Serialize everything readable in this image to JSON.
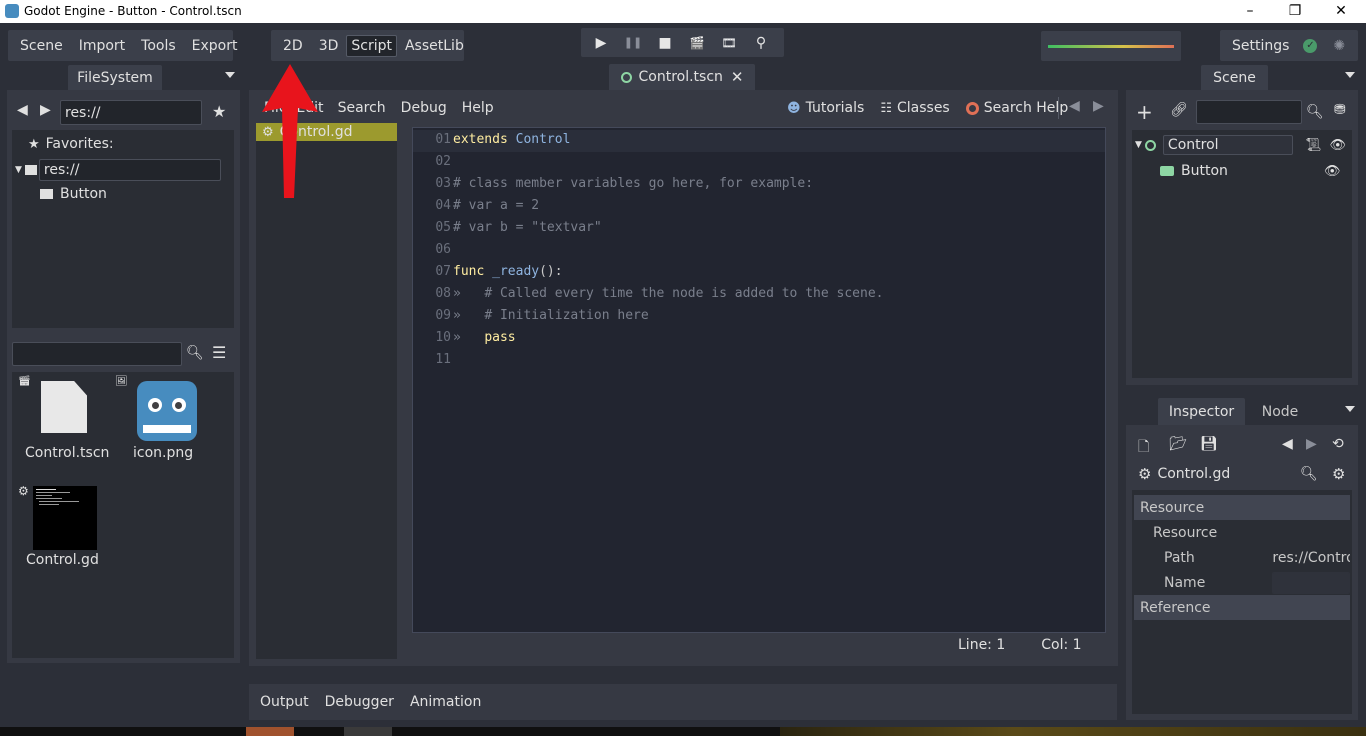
{
  "window": {
    "title": "Godot Engine - Button - Control.tscn",
    "minimize": "–",
    "restore": "❐",
    "close": "✕"
  },
  "menu": {
    "scene": "Scene",
    "import": "Import",
    "tools": "Tools",
    "export": "Export"
  },
  "workspaces": {
    "d2": "2D",
    "d3": "3D",
    "script": "Script",
    "assetlib": "AssetLib",
    "active": "Script"
  },
  "run": {
    "play": "▶",
    "pause": "❚❚",
    "stop": "■",
    "play_scene": "🎬",
    "play_custom": "🎞",
    "remote": "⚲"
  },
  "settings_label": "Settings",
  "filesystem": {
    "tab": "FileSystem",
    "path": "res://",
    "favorites": "Favorites:",
    "root": "res://",
    "folder": "Button",
    "search_placeholder": "",
    "files": [
      {
        "name": "Control.tscn",
        "type": "scene"
      },
      {
        "name": "icon.png",
        "type": "image"
      },
      {
        "name": "Control.gd",
        "type": "script"
      }
    ]
  },
  "editor": {
    "scene_tab": "Control.tscn",
    "script_menu": {
      "file": "File",
      "edit": "Edit",
      "search": "Search",
      "debug": "Debug",
      "help": "Help"
    },
    "links": {
      "tutorials": "Tutorials",
      "classes": "Classes",
      "search_help": "Search Help"
    },
    "script_list": [
      "Control.gd"
    ],
    "lines": [
      {
        "n": "01",
        "parts": [
          {
            "t": "extends",
            "c": "kw"
          },
          {
            "t": " ",
            "c": "tx"
          },
          {
            "t": "Control",
            "c": "tp"
          }
        ]
      },
      {
        "n": "02",
        "parts": []
      },
      {
        "n": "03",
        "parts": [
          {
            "t": "# class member variables go here, for example:",
            "c": "cm"
          }
        ]
      },
      {
        "n": "04",
        "parts": [
          {
            "t": "# var a = 2",
            "c": "cm"
          }
        ]
      },
      {
        "n": "05",
        "parts": [
          {
            "t": "# var b = \"textvar\"",
            "c": "cm"
          }
        ]
      },
      {
        "n": "06",
        "parts": []
      },
      {
        "n": "07",
        "parts": [
          {
            "t": "func",
            "c": "kw"
          },
          {
            "t": " ",
            "c": "tx"
          },
          {
            "t": "_ready",
            "c": "fn"
          },
          {
            "t": "():",
            "c": "tx"
          }
        ]
      },
      {
        "n": "08",
        "parts": [
          {
            "t": "»   ",
            "c": "cm"
          },
          {
            "t": "# Called every time the node is added to the scene.",
            "c": "cm"
          }
        ]
      },
      {
        "n": "09",
        "parts": [
          {
            "t": "»   ",
            "c": "cm"
          },
          {
            "t": "# Initialization here",
            "c": "cm"
          }
        ]
      },
      {
        "n": "10",
        "parts": [
          {
            "t": "»   ",
            "c": "cm"
          },
          {
            "t": "pass",
            "c": "kw"
          }
        ]
      },
      {
        "n": "11",
        "parts": []
      }
    ],
    "status": {
      "line": "Line: 1",
      "col": "Col: 1"
    }
  },
  "bottom": {
    "output": "Output",
    "debugger": "Debugger",
    "animation": "Animation"
  },
  "scene": {
    "tab": "Scene",
    "nodes": [
      {
        "name": "Control"
      },
      {
        "name": "Button"
      }
    ]
  },
  "inspector": {
    "tab_inspector": "Inspector",
    "tab_node": "Node",
    "object": "Control.gd",
    "section_resource": "Resource",
    "subsection_resource": "Resource",
    "path_label": "Path",
    "path_value": "res://Contro",
    "name_label": "Name",
    "section_reference": "Reference"
  },
  "colors": {
    "accent": "#478cbf",
    "current_script": "#9c9a2e",
    "bg": "#2c2f38",
    "panel": "#363943",
    "arrow": "#e8141c"
  }
}
